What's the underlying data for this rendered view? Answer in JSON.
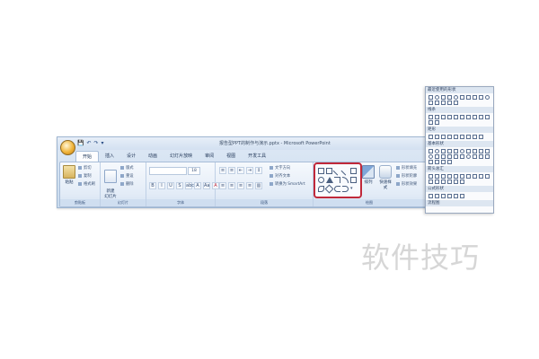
{
  "window": {
    "title": "报告型PPT的制作与演示.pptx - Microsoft PowerPoint",
    "qat": [
      "💾",
      "↶",
      "↷",
      "▾"
    ]
  },
  "tabs": [
    {
      "label": "开始",
      "active": true
    },
    {
      "label": "插入",
      "active": false
    },
    {
      "label": "设计",
      "active": false
    },
    {
      "label": "动画",
      "active": false
    },
    {
      "label": "幻灯片放映",
      "active": false
    },
    {
      "label": "审阅",
      "active": false
    },
    {
      "label": "视图",
      "active": false
    },
    {
      "label": "开发工具",
      "active": false
    }
  ],
  "ribbon": {
    "clipboard": {
      "label": "剪贴板",
      "paste": "粘贴",
      "cut": "剪切",
      "copy": "复制",
      "format_painter": "格式刷"
    },
    "slides": {
      "label": "幻灯片",
      "new_slide": "新建\n幻灯片",
      "layout": "版式",
      "reset": "重设",
      "delete": "删除"
    },
    "font": {
      "label": "字体",
      "size": "18",
      "glyphs": [
        "B",
        "I",
        "U",
        "S",
        "abc",
        "A",
        "Aa",
        "A"
      ]
    },
    "paragraph": {
      "label": "段落",
      "text_direction": "文字方向",
      "align_text": "对齐文本",
      "smartart": "转换为 SmartArt"
    },
    "drawing": {
      "label": "绘图",
      "arrange": "排列",
      "quick_styles": "快速样式",
      "shape_fill": "形状填充",
      "shape_outline": "形状轮廓",
      "shape_effects": "形状效果"
    }
  },
  "shapes_panel": {
    "sections": [
      "最近使用的形状",
      "线条",
      "矩形",
      "基本形状",
      "箭头总汇",
      "公式形状",
      "流程图"
    ]
  },
  "watermark": "软件技巧"
}
